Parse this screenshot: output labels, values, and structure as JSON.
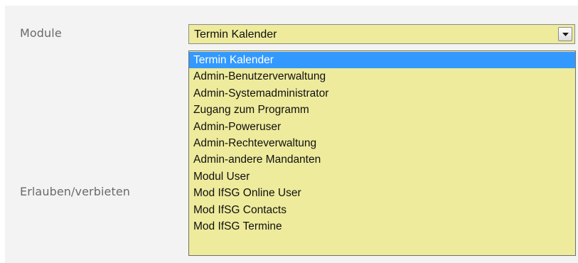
{
  "form": {
    "module_label": "Module",
    "allow_label": "Erlauben/verbieten"
  },
  "select": {
    "current_value": "Termin Kalender",
    "arrow_icon": "chevron-down-icon",
    "options": [
      "Termin Kalender",
      "Admin-Benutzerverwaltung",
      "Admin-Systemadministrator",
      "Zugang zum Programm",
      "Admin-Poweruser",
      "Admin-Rechteverwaltung",
      "Admin-andere Mandanten",
      "Modul User",
      "Mod IfSG Online User",
      "Mod IfSG Contacts",
      "Mod IfSG Termine"
    ],
    "highlighted_index": 0
  },
  "colors": {
    "field_background": "#eeeb9c",
    "highlight": "#3399ff",
    "panel_background": "#f3f3f3"
  }
}
